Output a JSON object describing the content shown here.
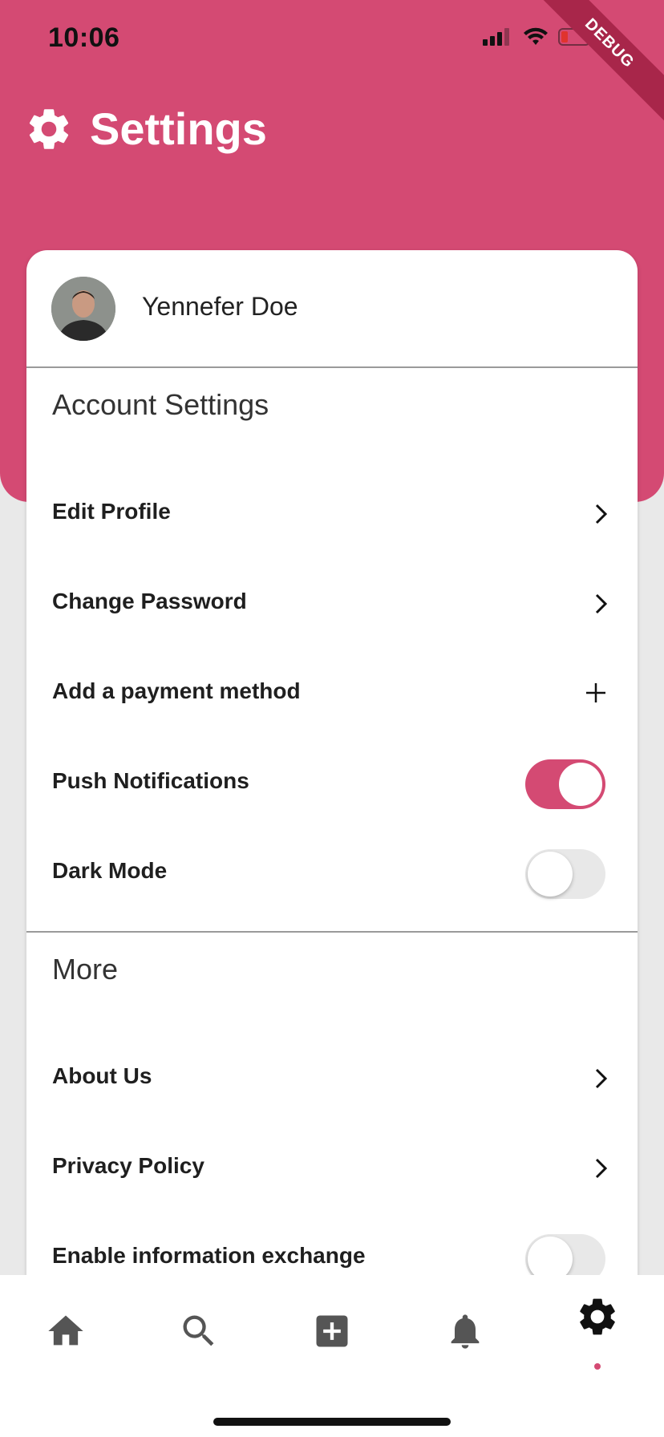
{
  "status_bar": {
    "time": "10:06",
    "debug_label": "DEBUG"
  },
  "header": {
    "title": "Settings",
    "icon": "gear-icon"
  },
  "profile": {
    "name": "Yennefer Doe"
  },
  "account_section": {
    "title": "Account Settings",
    "items": [
      {
        "label": "Edit Profile",
        "control": "chevron"
      },
      {
        "label": "Change Password",
        "control": "chevron"
      },
      {
        "label": "Add a payment method",
        "control": "plus"
      },
      {
        "label": "Push Notifications",
        "control": "toggle",
        "on": true
      },
      {
        "label": "Dark Mode",
        "control": "toggle",
        "on": false
      }
    ]
  },
  "more_section": {
    "title": "More",
    "items": [
      {
        "label": "About Us",
        "control": "chevron"
      },
      {
        "label": "Privacy Policy",
        "control": "chevron"
      },
      {
        "label": "Enable information exchange",
        "control": "toggle",
        "on": false
      }
    ]
  },
  "bottom_nav": {
    "items": [
      "home-icon",
      "search-icon",
      "add-box-icon",
      "bell-icon",
      "gear-icon"
    ],
    "active": "gear-icon"
  },
  "colors": {
    "accent": "#d44a73",
    "background": "#e9e9e9"
  }
}
